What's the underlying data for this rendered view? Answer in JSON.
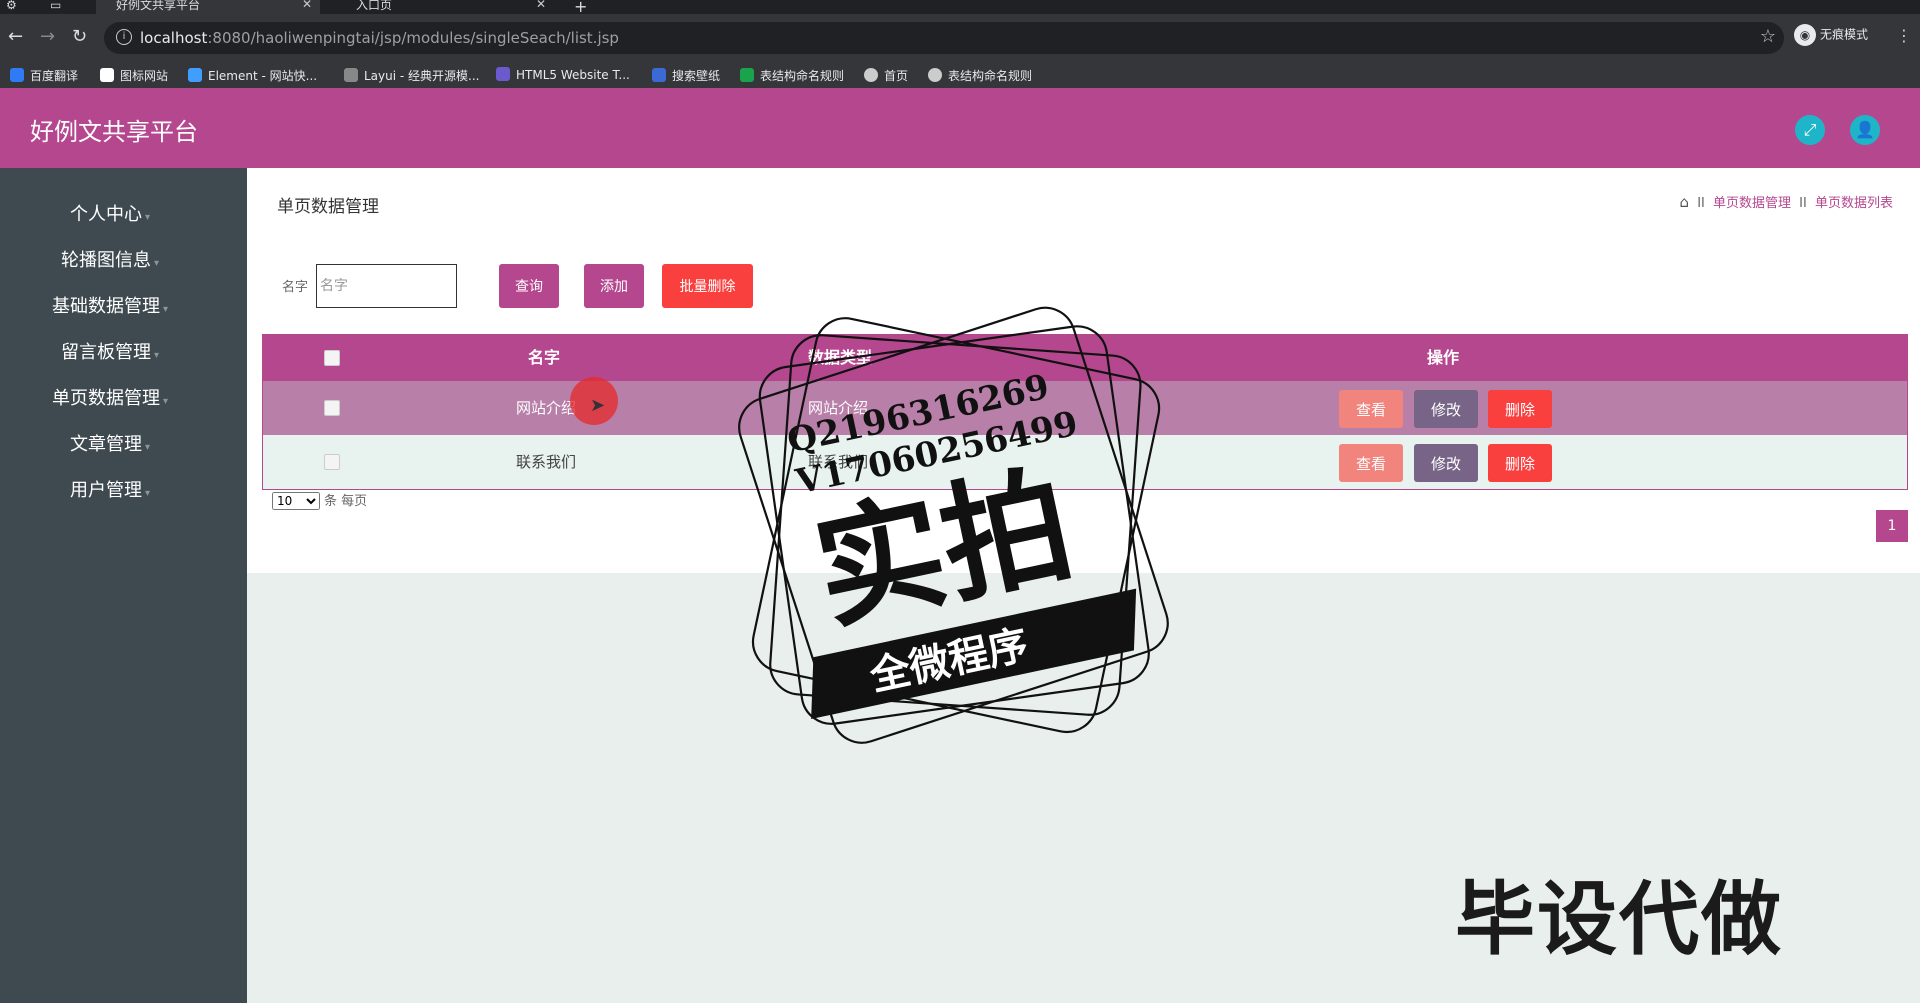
{
  "browser": {
    "tabs": [
      {
        "title": "好例文共享平台",
        "active": true
      },
      {
        "title": "入口页",
        "active": false
      }
    ],
    "url_host": "localhost",
    "url_rest": ":8080/haoliwenpingtai/jsp/modules/singleSeach/list.jsp",
    "incognito_label": "无痕模式",
    "bookmarks": [
      "百度翻译",
      "图标网站",
      "Element - 网站快...",
      "Layui - 经典开源模...",
      "HTML5 Website T...",
      "搜索壁纸",
      "表结构命名规则",
      "首页",
      "表结构命名规则"
    ]
  },
  "app": {
    "title": "好例文共享平台",
    "accent": "#b5478f"
  },
  "sidebar": {
    "items": [
      {
        "label": "个人中心"
      },
      {
        "label": "轮播图信息"
      },
      {
        "label": "基础数据管理"
      },
      {
        "label": "留言板管理"
      },
      {
        "label": "单页数据管理"
      },
      {
        "label": "文章管理"
      },
      {
        "label": "用户管理"
      }
    ]
  },
  "main": {
    "page_title": "单页数据管理",
    "breadcrumb": [
      "单页数据管理",
      "单页数据列表"
    ],
    "breadcrumb_sep": "II",
    "search": {
      "label": "名字",
      "placeholder": "名字",
      "query_button": "查询",
      "add_button": "添加",
      "batch_delete_button": "批量删除"
    },
    "table": {
      "columns": [
        "名字",
        "数据类型",
        "操作"
      ],
      "rows": [
        {
          "name": "网站介绍",
          "type": "网站介绍"
        },
        {
          "name": "联系我们",
          "type": "联系我们"
        }
      ],
      "actions": {
        "view": "查看",
        "edit": "修改",
        "delete": "删除"
      }
    },
    "pagination": {
      "page_size": "10",
      "page_size_suffix": "条 每页",
      "current_page": "1"
    }
  },
  "watermark": {
    "line1": "Q2196316269",
    "line2": "V17060256499",
    "big": "实拍",
    "ribbon": "全微程序",
    "bottom": "毕设代做"
  }
}
